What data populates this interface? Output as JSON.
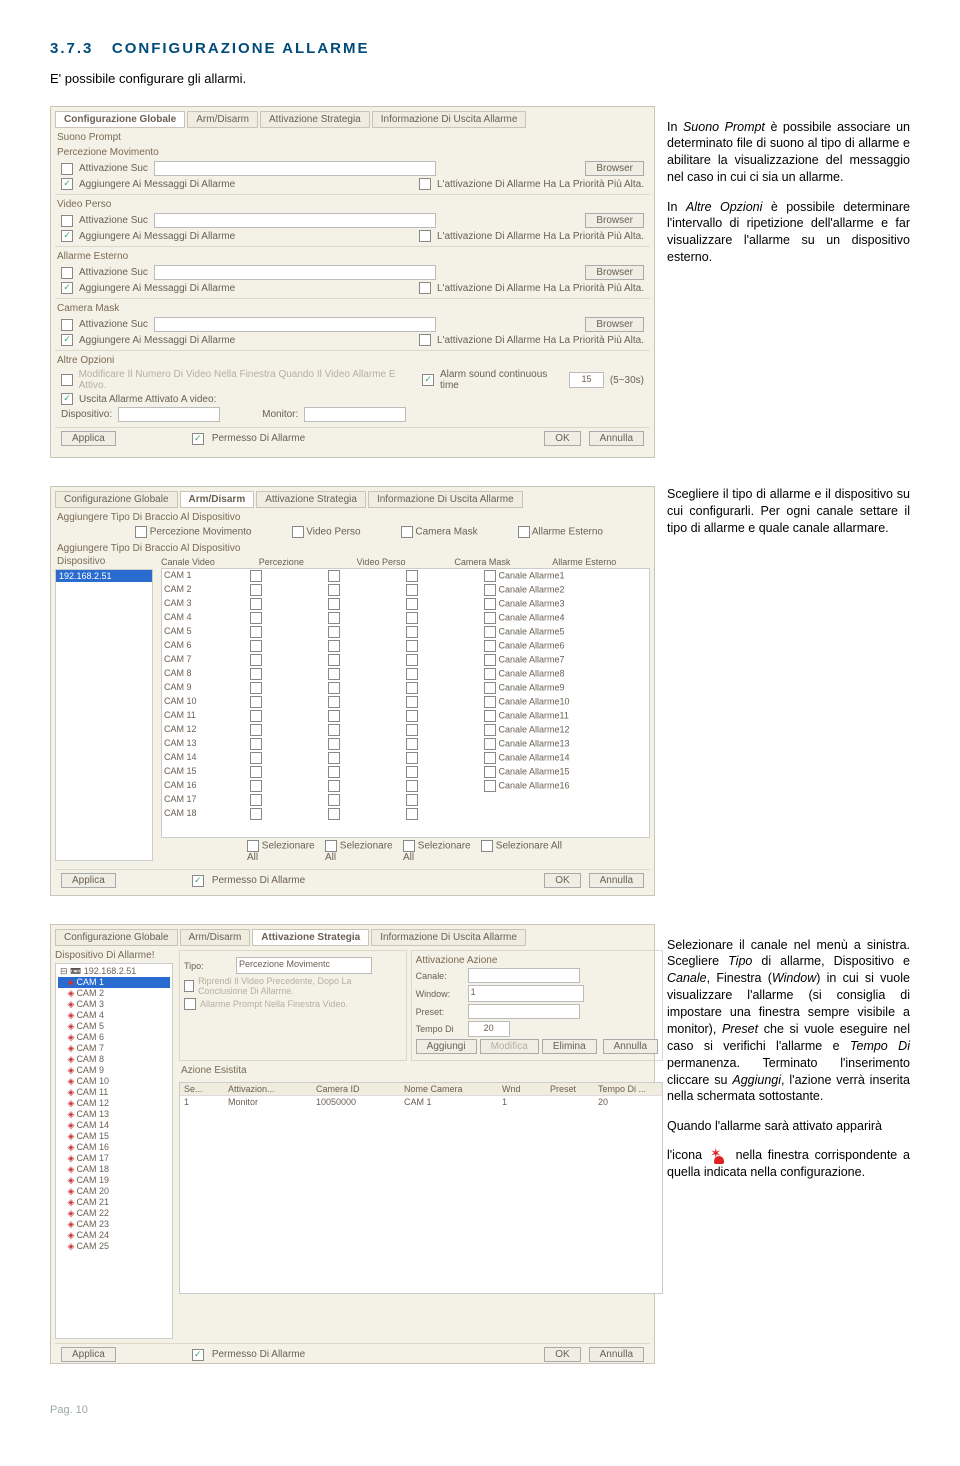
{
  "section": {
    "num": "3.7.3",
    "title": "CONFIGURAZIONE ALLARME"
  },
  "intro": "E' possibile configurare gli allarmi.",
  "side1": {
    "p1a": "In ",
    "p1b": "Suono Prompt",
    "p1c": " è possibile associare un determinato file di suono al tipo di allarme e abilitare la visualizzazione del messaggio nel caso in cui ci sia un allarme.",
    "p2a": "In ",
    "p2b": "Altre Opzioni",
    "p2c": " è possibile determinare l'intervallo di ripetizione dell'allarme e far visualizzare l'allarme su un dispositivo esterno."
  },
  "side2": "Scegliere il tipo di allarme e il dispositivo su cui configurarli. Per ogni canale settare il tipo di allarme e quale canale allarmare.",
  "side3": {
    "p1a": "Selezionare il canale nel menù a sinistra. Scegliere ",
    "p1b": "Tipo",
    "p1c": " di allarme, Dispositivo e ",
    "p1d": "Canale",
    "p1e": ", Finestra (",
    "p1f": "Window",
    "p1g": ") in cui si vuole visualizzare l'allarme (si consiglia di impostare una finestra sempre visibile a monitor), ",
    "p1h": "Preset",
    "p1i": " che si vuole eseguire nel caso si verifichi l'allarme e ",
    "p1j": "Tempo Di",
    "p1k": " permanenza. Terminato l'inserimento cliccare su ",
    "p1l": "Aggiungi",
    "p1m": ", l'azione verrà inserita nella schermata sottostante.",
    "p2a": "Quando l'allarme sarà attivato apparirà",
    "p3a": "l'icona ",
    "p3b": " nella finestra corrispondente a quella indicata nella configurazione."
  },
  "ui": {
    "tabs": [
      "Configurazione Globale",
      "Arm/Disarm",
      "Attivazione Strategia",
      "Informazione Di Uscita Allarme"
    ],
    "p1": {
      "suono_prompt": "Suono Prompt",
      "groups": [
        "Percezione Movimento",
        "Video Perso",
        "Allarme Esterno",
        "Camera Mask"
      ],
      "att_suc": "Attivazione Suc",
      "browser": "Browser",
      "agg_msg": "Aggiungere Ai Messaggi Di Allarme",
      "priorita": "L'attivazione Di Allarme Ha La Priorità Più Alta.",
      "altre_opzioni": "Altre Opzioni",
      "modif": "Modificare Il Numero Di Video Nella Finestra Quando Il Video Allarme E Attivo.",
      "uscita": "Uscita Allarme Attivato A video:",
      "sound_cont": "Alarm sound continuous time",
      "sound_val": "15",
      "sound_range": "(5~30s)",
      "dispositivo": "Dispositivo:",
      "monitor": "Monitor:"
    },
    "p2": {
      "agg_tipo_disp": "Aggiungere Tipo Di Braccio Al Dispositivo",
      "opts": [
        "Percezione Movimento",
        "Video Perso",
        "Camera Mask",
        "Allarme Esterno"
      ],
      "agg_tipo_al_disp": "Aggiungere Tipo Di Braccio Al Dispositivo",
      "dispositivo_lbl": "Dispositivo",
      "device_ip": "192.168.2.51",
      "headers": [
        "Canale Video",
        "Percezione",
        "Video Perso",
        "Camera Mask",
        "Allarme Esterno"
      ],
      "cam_prefix": "CAM ",
      "canale_prefix": "Canale Allarme",
      "sel_all": "Selezionare All"
    },
    "p3": {
      "disp_allarme": "Dispositivo Di Allarme!",
      "root_ip": "192.168.2.51",
      "cam_count": 25,
      "tipo": "Tipo:",
      "tipo_val": "Percezione Movimentc",
      "riprendi": "Riprendi Il Video Precedente, Dopo La Conclusione Di Allarme.",
      "allarme_prompt": "Allarme Prompt Nella Finestra Video.",
      "att_azione": "Attivazione Azione",
      "canale": "Canale:",
      "window": "Window:",
      "window_val": "1",
      "preset": "Preset:",
      "tempo": "Tempo Di",
      "tempo_val": "20",
      "aggiungi": "Aggiungi",
      "modifica": "Modifica",
      "elimina": "Elimina",
      "annulla": "Annulla",
      "az_esistita": "Azione Esistita",
      "action_headers": [
        "Se...",
        "Attivazion...",
        "Camera ID",
        "Nome Camera",
        "Wnd",
        "Preset",
        "Tempo Di ..."
      ],
      "action_row": [
        "1",
        "Monitor",
        "10050000",
        "CAM 1",
        "1",
        "",
        "20"
      ]
    },
    "bottom": {
      "applica": "Applica",
      "permesso": "Permesso Di Allarme",
      "ok": "OK",
      "annulla": "Annulla"
    }
  },
  "footer": "Pag. 10"
}
